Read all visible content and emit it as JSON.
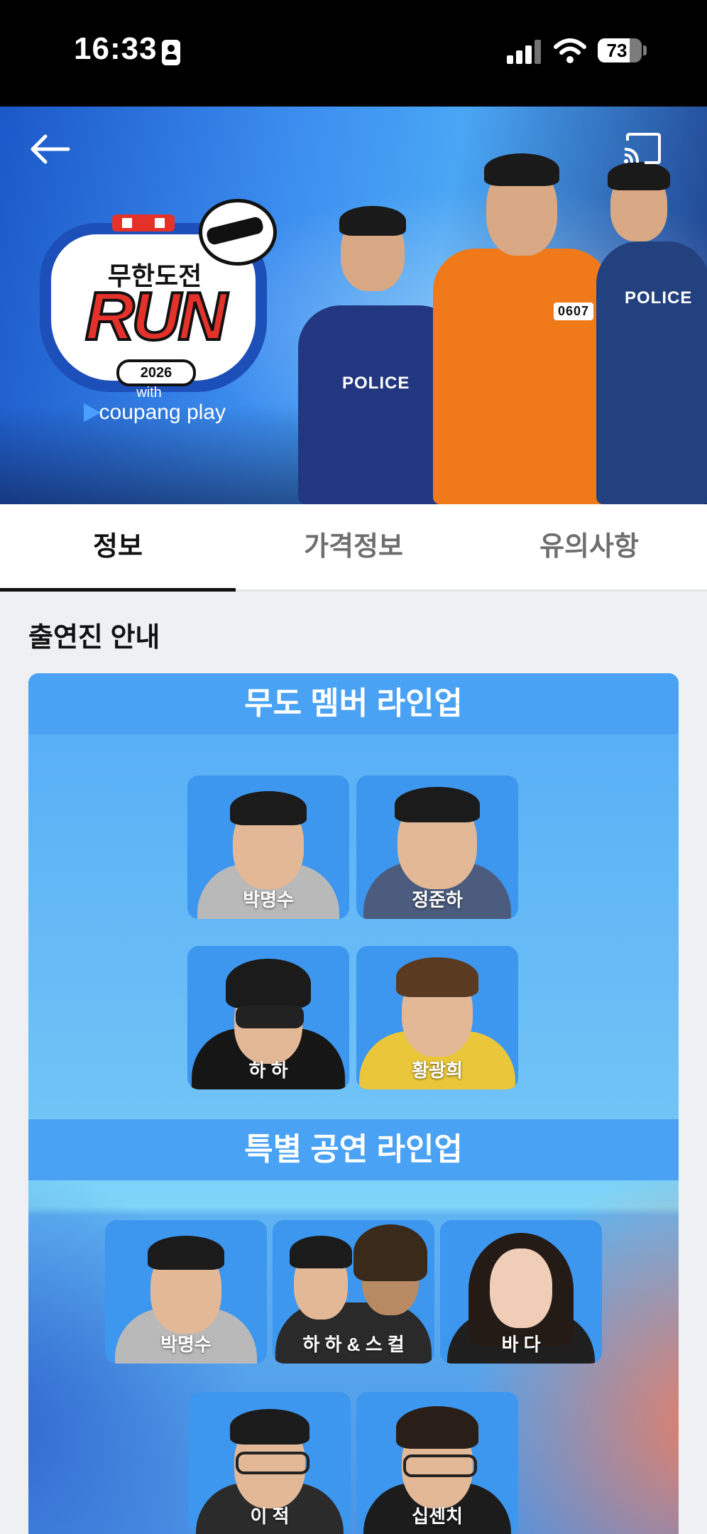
{
  "status_bar": {
    "time": "16:33",
    "battery": "73",
    "battery_level": 0.73
  },
  "hero": {
    "logo_title_kr": "무한도전",
    "logo_title_en": "RUN",
    "logo_year": "2026",
    "logo_with": "with",
    "logo_partner": "coupang play",
    "badge_text": "POLICE",
    "badge_text_2": "POLICE",
    "prisoner_number": "0607"
  },
  "tabs": [
    {
      "label": "정보",
      "active": true
    },
    {
      "label": "가격정보",
      "active": false
    },
    {
      "label": "유의사항",
      "active": false
    }
  ],
  "content": {
    "section_title": "출연진 안내",
    "lineup_1": {
      "title": "무도 멤버 라인업",
      "members": [
        "박명수",
        "정준하",
        "하 하",
        "황광희"
      ]
    },
    "lineup_2": {
      "title": "특별 공연 라인업",
      "members": [
        "박명수",
        "하 하 & 스 컬",
        "바 다",
        "이 적",
        "십센치"
      ]
    }
  },
  "colors": {
    "accent": "#4aa2f4",
    "tab_active": "#111111",
    "tab_inactive": "#6e6e6e"
  },
  "icons": [
    "back-arrow-icon",
    "cast-icon",
    "signal-icon",
    "wifi-icon",
    "battery-icon",
    "id-card-icon"
  ]
}
